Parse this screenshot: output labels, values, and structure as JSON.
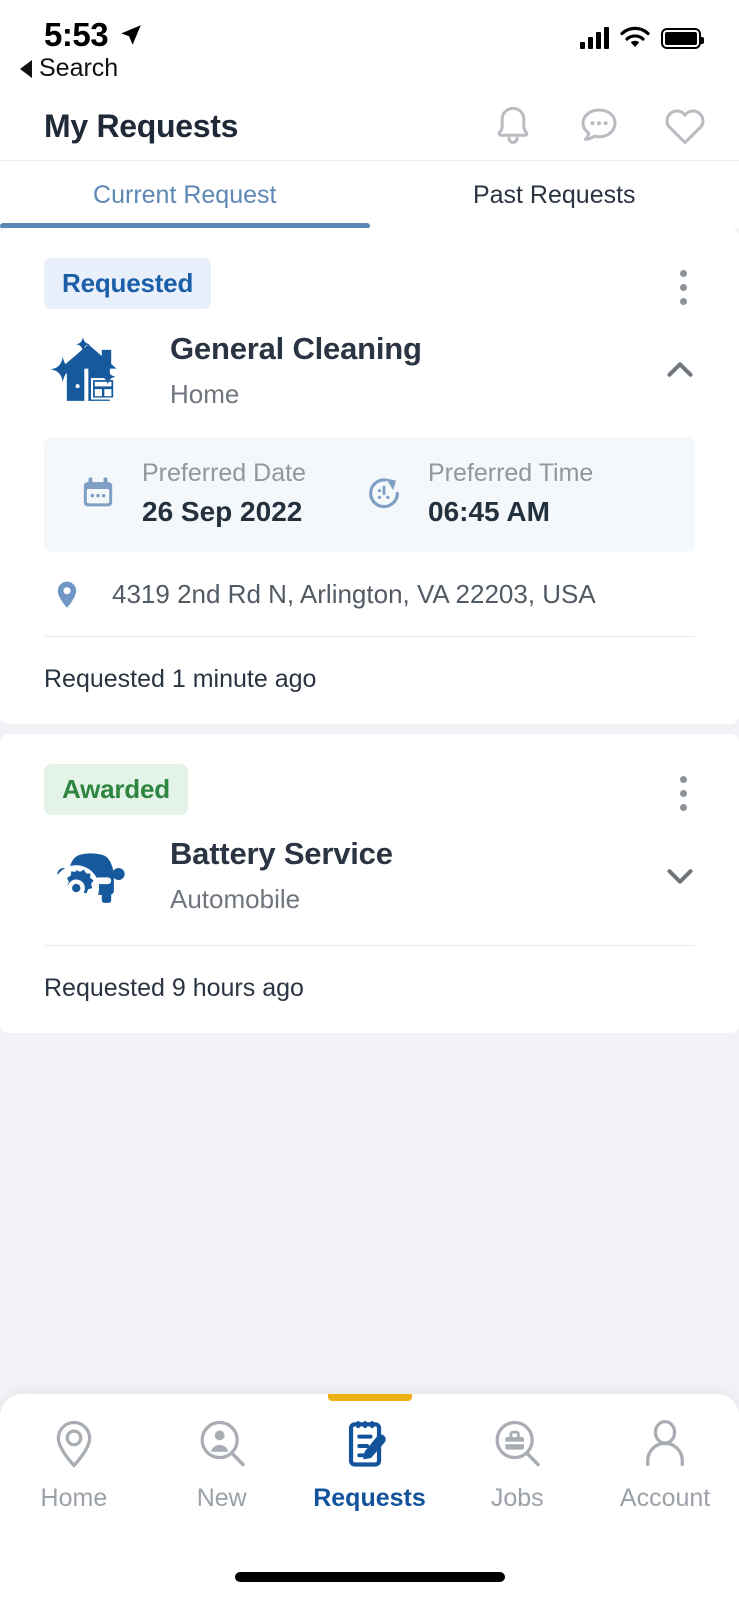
{
  "status_bar": {
    "time": "5:53",
    "location_icon": "location-arrow-icon",
    "signal_icon": "cellular-signal-icon",
    "wifi_icon": "wifi-icon",
    "battery_icon": "battery-full-icon"
  },
  "back_link": {
    "label": "Search",
    "icon": "back-triangle-icon"
  },
  "header": {
    "title": "My Requests",
    "icons": [
      {
        "name": "notifications-bell-icon",
        "label": "Notifications"
      },
      {
        "name": "chat-bubble-icon",
        "label": "Messages"
      },
      {
        "name": "heart-icon",
        "label": "Favorites"
      }
    ]
  },
  "tabs": [
    {
      "label": "Current Request",
      "active": true
    },
    {
      "label": "Past Requests",
      "active": false
    }
  ],
  "colors": {
    "accent_blue": "#12539c",
    "tab_active": "#5d87b5",
    "badge_requested_bg": "#e9effb",
    "badge_requested_text": "#1a5fa8",
    "badge_awarded_bg": "#e4f3e7",
    "badge_awarded_text": "#2e8540",
    "nav_indicator": "#edb211",
    "page_bg": "#f1f3f6",
    "card_bg": "#ffffff",
    "panel_bg": "#f4f8fb"
  },
  "requests": [
    {
      "status": "Requested",
      "status_type": "requested",
      "service_icon": "house-sparkle-cleaning-icon",
      "title": "General Cleaning",
      "category": "Home",
      "expanded": true,
      "chevron": "chevron-up-icon",
      "menu_icon": "kebab-menu-icon",
      "details": {
        "date_label": "Preferred Date",
        "date_value": "26 Sep 2022",
        "date_icon": "calendar-icon",
        "time_label": "Preferred Time",
        "time_value": "06:45 AM",
        "time_icon": "stopwatch-icon"
      },
      "address_icon": "map-pin-icon",
      "address": "4319 2nd Rd N, Arlington, VA 22203, USA",
      "requested_ago": "Requested 1 minute ago"
    },
    {
      "status": "Awarded",
      "status_type": "awarded",
      "service_icon": "car-gear-battery-service-icon",
      "title": "Battery Service",
      "category": "Automobile",
      "expanded": false,
      "chevron": "chevron-down-icon",
      "menu_icon": "kebab-menu-icon",
      "requested_ago": "Requested 9 hours ago"
    }
  ],
  "bottom_nav": [
    {
      "label": "Home",
      "icon": "map-pin-outline-icon",
      "active": false
    },
    {
      "label": "New",
      "icon": "person-search-icon",
      "active": false
    },
    {
      "label": "Requests",
      "icon": "notepad-pencil-icon",
      "active": true
    },
    {
      "label": "Jobs",
      "icon": "briefcase-search-icon",
      "active": false
    },
    {
      "label": "Account",
      "icon": "person-outline-icon",
      "active": false
    }
  ]
}
